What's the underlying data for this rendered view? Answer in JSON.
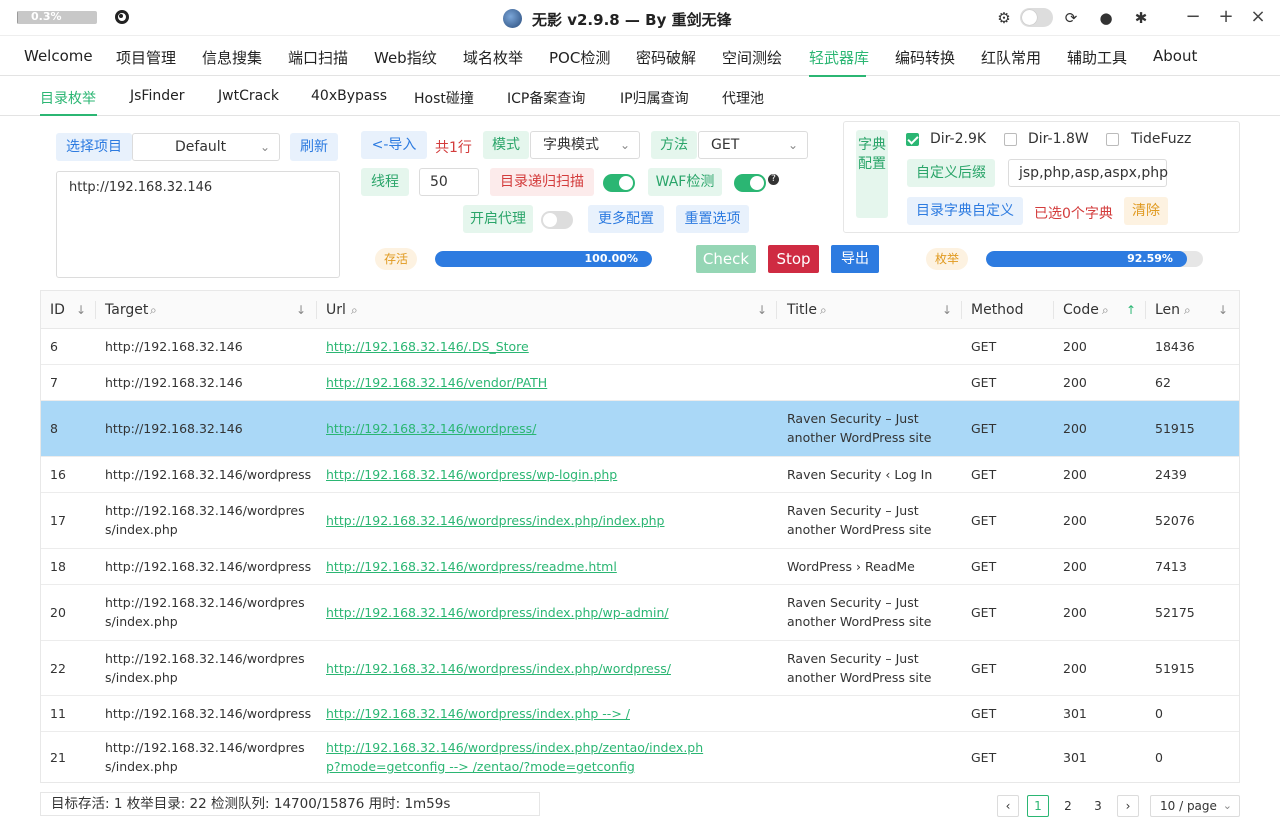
{
  "titlebar": {
    "memory": "0.3%",
    "memory_fraction": 0.003,
    "title": "无影 v2.9.8 — By 重剑无锋"
  },
  "menu": [
    "Welcome",
    "项目管理",
    "信息搜集",
    "端口扫描",
    "Web指纹",
    "域名枚举",
    "POC检测",
    "密码破解",
    "空间测绘",
    "轻武器库",
    "编码转换",
    "红队常用",
    "辅助工具",
    "About"
  ],
  "menu_active": "轻武器库",
  "subtabs": [
    "目录枚举",
    "JsFinder",
    "JwtCrack",
    "40xBypass",
    "Host碰撞",
    "ICP备案查询",
    "IP归属查询",
    "代理池"
  ],
  "subtab_active": "目录枚举",
  "controls": {
    "select_project_label": "选择项目",
    "project_value": "Default",
    "refresh_label": "刷新",
    "targets_text": "http://192.168.32.146",
    "import_label": "<-导入",
    "line_count": "共1行",
    "mode_label": "模式",
    "mode_value": "字典模式",
    "method_label": "方法",
    "method_value": "GET",
    "threads_label": "线程",
    "threads_value": "50",
    "recursive_label": "目录递归扫描",
    "recursive_on": true,
    "waf_label": "WAF检测",
    "waf_on": true,
    "proxy_label": "开启代理",
    "proxy_on": false,
    "more_config_label": "更多配置",
    "reset_label": "重置选项"
  },
  "dict": {
    "label": "字典配置",
    "options": [
      {
        "label": "Dir-2.9K",
        "checked": true
      },
      {
        "label": "Dir-1.8W",
        "checked": false
      },
      {
        "label": "TideFuzz",
        "checked": false
      }
    ],
    "custom_suffix_label": "自定义后缀",
    "suffix_value": "jsp,php,asp,aspx,php",
    "custom_dict_label": "目录字典自定义",
    "selected_text": "已选0个字典",
    "clear_label": "清除"
  },
  "progress": {
    "alive_label": "存活",
    "alive_value": "100.00%",
    "alive_fraction": 1.0,
    "check_label": "Check",
    "stop_label": "Stop",
    "export_label": "导出",
    "enum_label": "枚举",
    "enum_value": "92.59%",
    "enum_fraction": 0.9259
  },
  "table": {
    "headers": [
      "ID",
      "Target",
      "Url",
      "Title",
      "Method",
      "Code",
      "Len"
    ],
    "rows": [
      {
        "id": "6",
        "target": "http://192.168.32.146",
        "url": "http://192.168.32.146/.DS_Store",
        "title": "",
        "method": "GET",
        "code": "200",
        "len": "18436",
        "selected": false
      },
      {
        "id": "7",
        "target": "http://192.168.32.146",
        "url": "http://192.168.32.146/vendor/PATH",
        "title": "",
        "method": "GET",
        "code": "200",
        "len": "62",
        "selected": false
      },
      {
        "id": "8",
        "target": "http://192.168.32.146",
        "url": "http://192.168.32.146/wordpress/",
        "title": "Raven Security – Just another WordPress site",
        "method": "GET",
        "code": "200",
        "len": "51915",
        "selected": true
      },
      {
        "id": "16",
        "target": "http://192.168.32.146/wordpress",
        "url": "http://192.168.32.146/wordpress/wp-login.php",
        "title": "Raven Security ‹ Log In",
        "method": "GET",
        "code": "200",
        "len": "2439",
        "selected": false
      },
      {
        "id": "17",
        "target": "http://192.168.32.146/wordpress/index.php",
        "url": "http://192.168.32.146/wordpress/index.php/index.php",
        "title": "Raven Security – Just another WordPress site",
        "method": "GET",
        "code": "200",
        "len": "52076",
        "selected": false
      },
      {
        "id": "18",
        "target": "http://192.168.32.146/wordpress",
        "url": "http://192.168.32.146/wordpress/readme.html",
        "title": "WordPress › ReadMe",
        "method": "GET",
        "code": "200",
        "len": "7413",
        "selected": false
      },
      {
        "id": "20",
        "target": "http://192.168.32.146/wordpress/index.php",
        "url": "http://192.168.32.146/wordpress/index.php/wp-admin/",
        "title": "Raven Security – Just another WordPress site",
        "method": "GET",
        "code": "200",
        "len": "52175",
        "selected": false
      },
      {
        "id": "22",
        "target": "http://192.168.32.146/wordpress/index.php",
        "url": "http://192.168.32.146/wordpress/index.php/wordpress/",
        "title": "Raven Security – Just another WordPress site",
        "method": "GET",
        "code": "200",
        "len": "51915",
        "selected": false
      },
      {
        "id": "11",
        "target": "http://192.168.32.146/wordpress",
        "url": "http://192.168.32.146/wordpress/index.php --> /",
        "title": "",
        "method": "GET",
        "code": "301",
        "len": "0",
        "selected": false
      },
      {
        "id": "21",
        "target": "http://192.168.32.146/wordpress/index.php",
        "url": "http://192.168.32.146/wordpress/index.php/zentao/index.php?mode=getconfig --> /zentao/?mode=getconfig",
        "title": "",
        "method": "GET",
        "code": "301",
        "len": "0",
        "selected": false
      }
    ]
  },
  "footer": {
    "status": "目标存活: 1   枚举目录: 22   检测队列: 14700/15876   用时: 1m59s",
    "pages": [
      "1",
      "2",
      "3"
    ],
    "current_page": "1",
    "page_size": "10 / page"
  },
  "colors": {
    "accent": "#2bb673",
    "primary": "#2d7be0",
    "danger": "#d33c3c",
    "selected_row": "#aad8f7"
  }
}
